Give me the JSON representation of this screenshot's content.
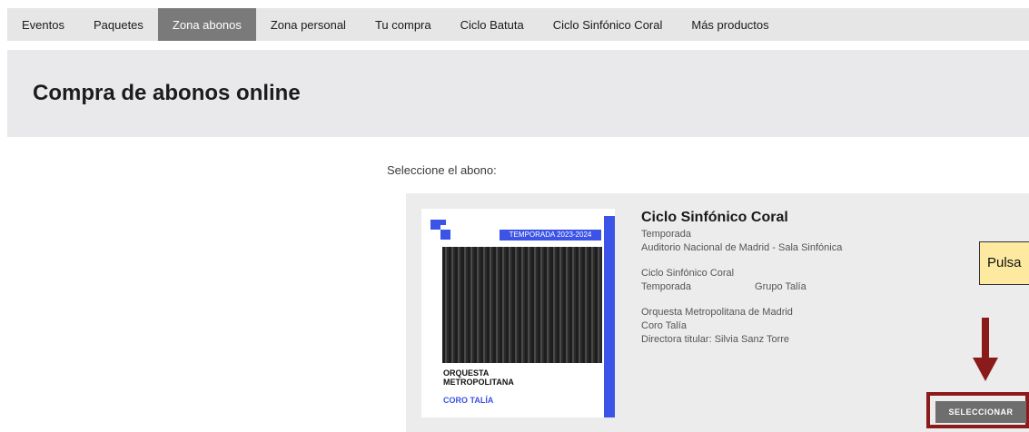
{
  "nav": {
    "items": [
      {
        "label": "Eventos",
        "active": false
      },
      {
        "label": "Paquetes",
        "active": false
      },
      {
        "label": "Zona abonos",
        "active": true
      },
      {
        "label": "Zona personal",
        "active": false
      },
      {
        "label": "Tu compra",
        "active": false
      },
      {
        "label": "Ciclo Batuta",
        "active": false
      },
      {
        "label": "Ciclo Sinfónico Coral",
        "active": false
      },
      {
        "label": "Más productos",
        "active": false
      }
    ]
  },
  "header": {
    "title": "Compra de abonos online"
  },
  "main": {
    "prompt": "Seleccione el abono:",
    "subscription": {
      "name": "Ciclo Sinfónico Coral",
      "season": "Temporada",
      "venue": "Auditorio Nacional de Madrid - Sala Sinfónica",
      "cycle": "Ciclo Sinfónico Coral",
      "season2": "Temporada",
      "group": "Grupo Talía",
      "orchestra": "Orquesta Metropolitana de Madrid",
      "choir": "Coro Talía",
      "director": "Directora titular: Silvia Sanz Torre",
      "poster": {
        "season_label": "TEMPORADA 2023-2024",
        "orchestra_title": "ORQUESTA METROPOLITANA",
        "choir_title": "CORO TALÍA"
      },
      "select_label": "SELECCIONAR"
    }
  },
  "annotation": {
    "callout_text": "Pulsa"
  },
  "colors": {
    "accent": "#3b53e6",
    "nav_active": "#7a7a7a",
    "highlight": "#8b1a1a",
    "callout": "#fde9a0"
  }
}
